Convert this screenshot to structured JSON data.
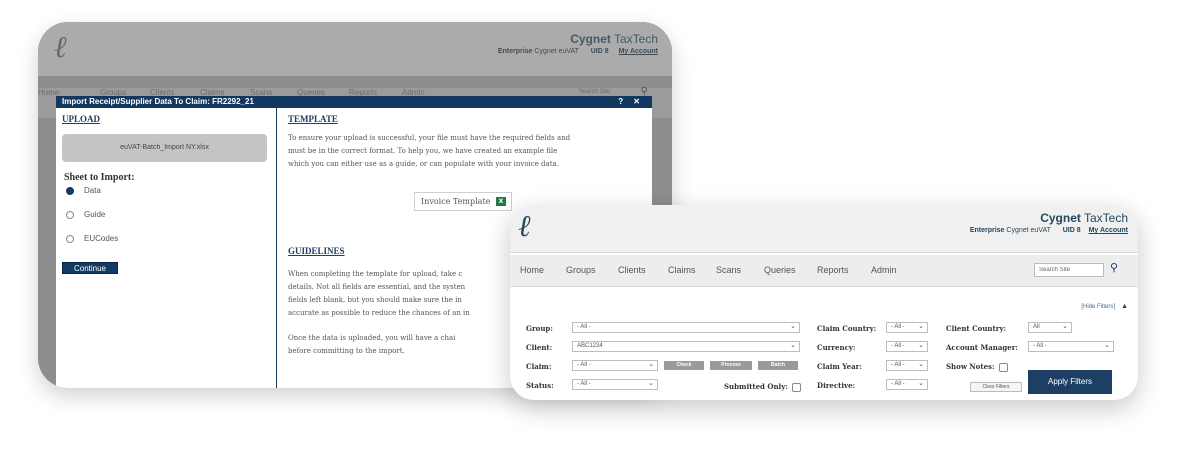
{
  "brand": {
    "name_bold": "Cygnet",
    "name_rest": " TaxTech",
    "plan_bold": "Enterprise",
    "plan_rest": " Cygnet euVAT",
    "uid": "UID 8",
    "account": "My Account"
  },
  "back_window": {
    "nav": [
      "Home",
      "Groups",
      "Clients",
      "Claims",
      "Scans",
      "Queries",
      "Reports",
      "Admin"
    ],
    "search_placeholder": "Search Site",
    "dialog": {
      "title": "Import Receipt/Supplier Data To Claim: FR2292_21",
      "controls": "? ✕",
      "upload_title": "UPLOAD",
      "file_name": "euVAT-Batch_Import NY.xlsx",
      "sheet_label": "Sheet to Import:",
      "sheets": [
        {
          "label": "Data",
          "selected": true
        },
        {
          "label": "Guide",
          "selected": false
        },
        {
          "label": "EUCodes",
          "selected": false
        }
      ],
      "continue_label": "Continue",
      "template_title": "TEMPLATE",
      "template_text_1": "To ensure your upload is successful, your file must have the required fields and",
      "template_text_2": "must be in the correct format. To help you, we have created an example file",
      "template_text_3": "which you can either use as a guide, or can populate with your invoice data.",
      "invoice_button": "Invoice Template",
      "guidelines_title": "GUIDELINES",
      "guide_text_1": "When completing the template for upload, take c",
      "guide_text_2": "details. Not all fields are essential, and the systen",
      "guide_text_3": "fields left blank, but you should make sure the in",
      "guide_text_4": "accurate as possible to reduce the chances of an in",
      "guide_text_5": "Once the data is uploaded, you will have a chai",
      "guide_text_6": "before committing to the import."
    }
  },
  "front_window": {
    "nav": [
      "Home",
      "Groups",
      "Clients",
      "Claims",
      "Scans",
      "Queries",
      "Reports",
      "Admin"
    ],
    "search_placeholder": "Search Site",
    "hide_filters": "[Hide Filters]",
    "filters": {
      "group_label": "Group:",
      "group_value": "- All -",
      "client_label": "Client:",
      "client_value": "ABC1234",
      "claim_label": "Claim:",
      "claim_value": "- All -",
      "status_label": "Status:",
      "status_value": "- All -",
      "check_label": "Check",
      "process_label": "Process",
      "batch_label": "Batch",
      "submitted_only_label": "Submitted Only:",
      "claim_country_label": "Claim Country:",
      "claim_country_value": "- All -",
      "currency_label": "Currency:",
      "currency_value": "- All -",
      "claim_year_label": "Claim Year:",
      "claim_year_value": "- All -",
      "directive_label": "Directive:",
      "directive_value": "- All -",
      "client_country_label": "Client Country:",
      "client_country_value": "All",
      "account_manager_label": "Account Manager:",
      "account_manager_value": "- All -",
      "show_notes_label": "Show Notes:",
      "clear_filters_label": "Clear Filters",
      "apply_filters_label": "Apply Filters"
    }
  }
}
